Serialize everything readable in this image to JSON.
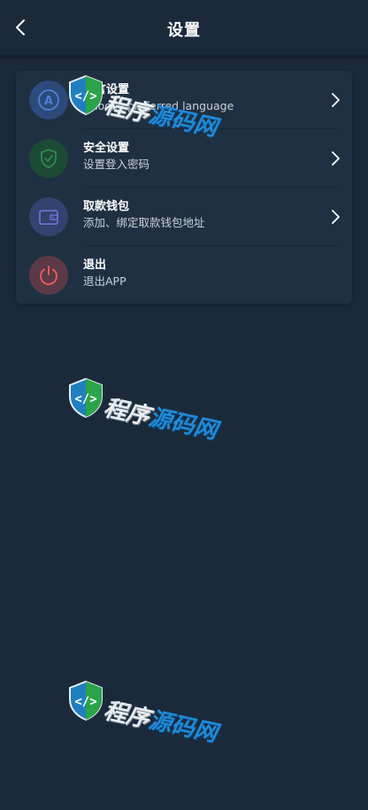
{
  "header": {
    "title": "设置",
    "back_icon": "chevron-left-icon"
  },
  "settings": {
    "items": [
      {
        "id": "language",
        "label": "语言设置",
        "sub": "Choose preferred language",
        "icon": "language-icon",
        "icon_bg": "#2c4a7a",
        "icon_color": "#4f7fd6",
        "has_chevron": true
      },
      {
        "id": "security",
        "label": "安全设置",
        "sub": "设置登入密码",
        "icon": "shield-check-icon",
        "icon_bg": "#1c4a35",
        "icon_color": "#2f8a4c",
        "has_chevron": true
      },
      {
        "id": "wallet",
        "label": "取款钱包",
        "sub": "添加、绑定取款钱包地址",
        "icon": "wallet-icon",
        "icon_bg": "#33426e",
        "icon_color": "#6e6fd0",
        "has_chevron": true
      },
      {
        "id": "logout",
        "label": "退出",
        "sub": "退出APP",
        "icon": "power-icon",
        "icon_bg": "#5a3a46",
        "icon_color": "#e25b5b",
        "has_chevron": false
      }
    ]
  },
  "watermark": {
    "text_part1": "程序",
    "text_part2": "源码网"
  }
}
